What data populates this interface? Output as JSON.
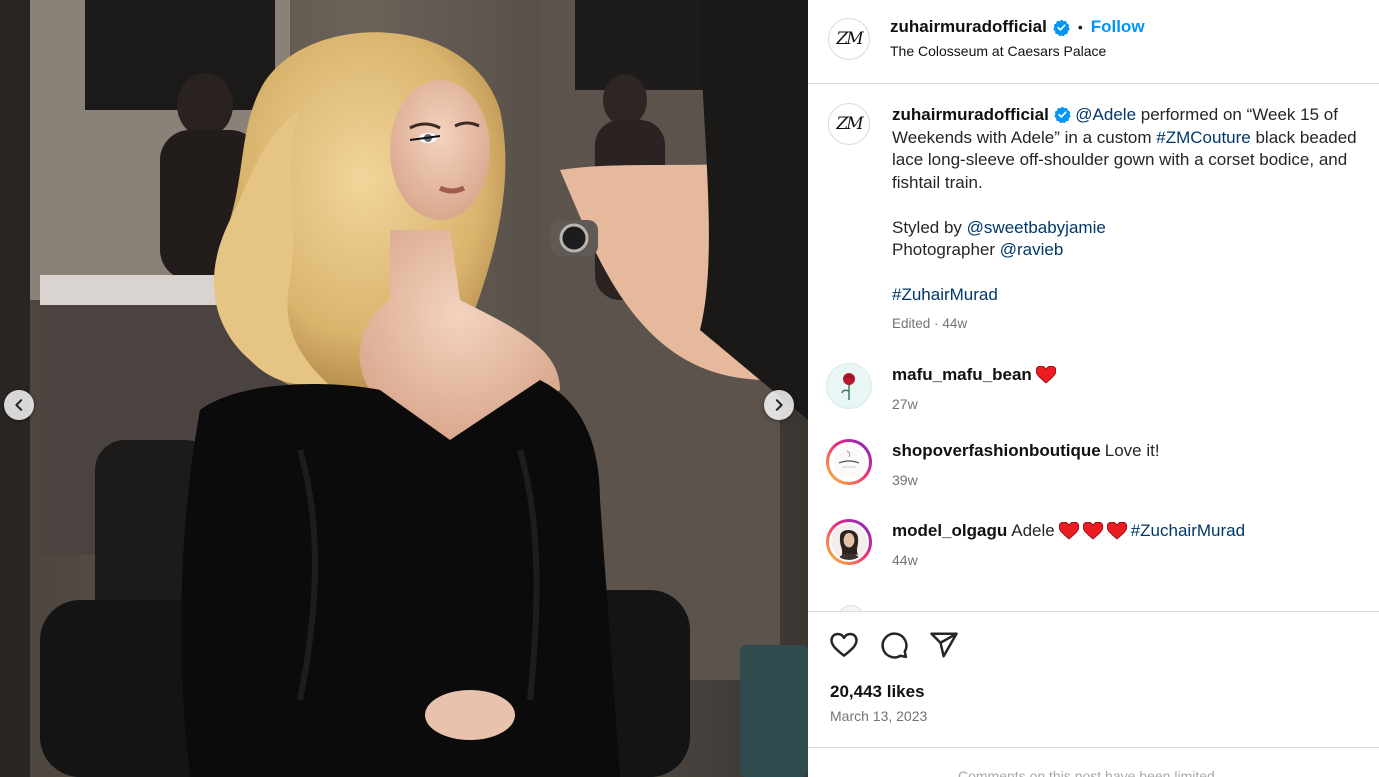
{
  "post": {
    "username": "zuhairmuradofficial",
    "avatar_text": "ZM",
    "follow_label": "Follow",
    "separator": "•",
    "location": "The Colosseum at Caesars Palace"
  },
  "caption": {
    "username": "zuhairmuradofficial",
    "mention_adele": "@Adele",
    "text_1": " performed on “Week 15 of Weekends with Adele” in a custom ",
    "hashtag_couture": "#ZMCouture",
    "text_2": " black beaded lace long-sleeve off-shoulder gown with a corset bodice, and fishtail train.",
    "styled_by_label": "Styled by ",
    "styled_by_handle": "@sweetbabyjamie",
    "photographer_label": "Photographer ",
    "photographer_handle": "@ravieb",
    "hashtag_brand": "#ZuhairMurad",
    "edited_label": "Edited",
    "meta_separator": "·",
    "time": "44w"
  },
  "comments": [
    {
      "username": "mafu_mafu_bean",
      "text": "",
      "hearts": 1,
      "time": "27w",
      "avatar": "rose-icon"
    },
    {
      "username": "shopoverfashionboutique",
      "text": "Love it!",
      "hearts": 0,
      "time": "39w",
      "avatar": "boutique-logo"
    },
    {
      "username": "model_olgagu",
      "text": "Adele",
      "hearts": 3,
      "hashtag": "#ZuchairMurad",
      "time": "44w",
      "avatar": "portrait"
    }
  ],
  "actions": {
    "like_icon": "heart-outline-icon",
    "comment_icon": "comment-icon",
    "share_icon": "paper-plane-icon"
  },
  "stats": {
    "likes": "20,443 likes",
    "date": "March 13, 2023"
  },
  "footer": {
    "text": "Comments on this post have been limited."
  },
  "colors": {
    "accent": "#0095f6",
    "link": "#00376b",
    "heart": "#ed4956",
    "muted": "#737373"
  }
}
